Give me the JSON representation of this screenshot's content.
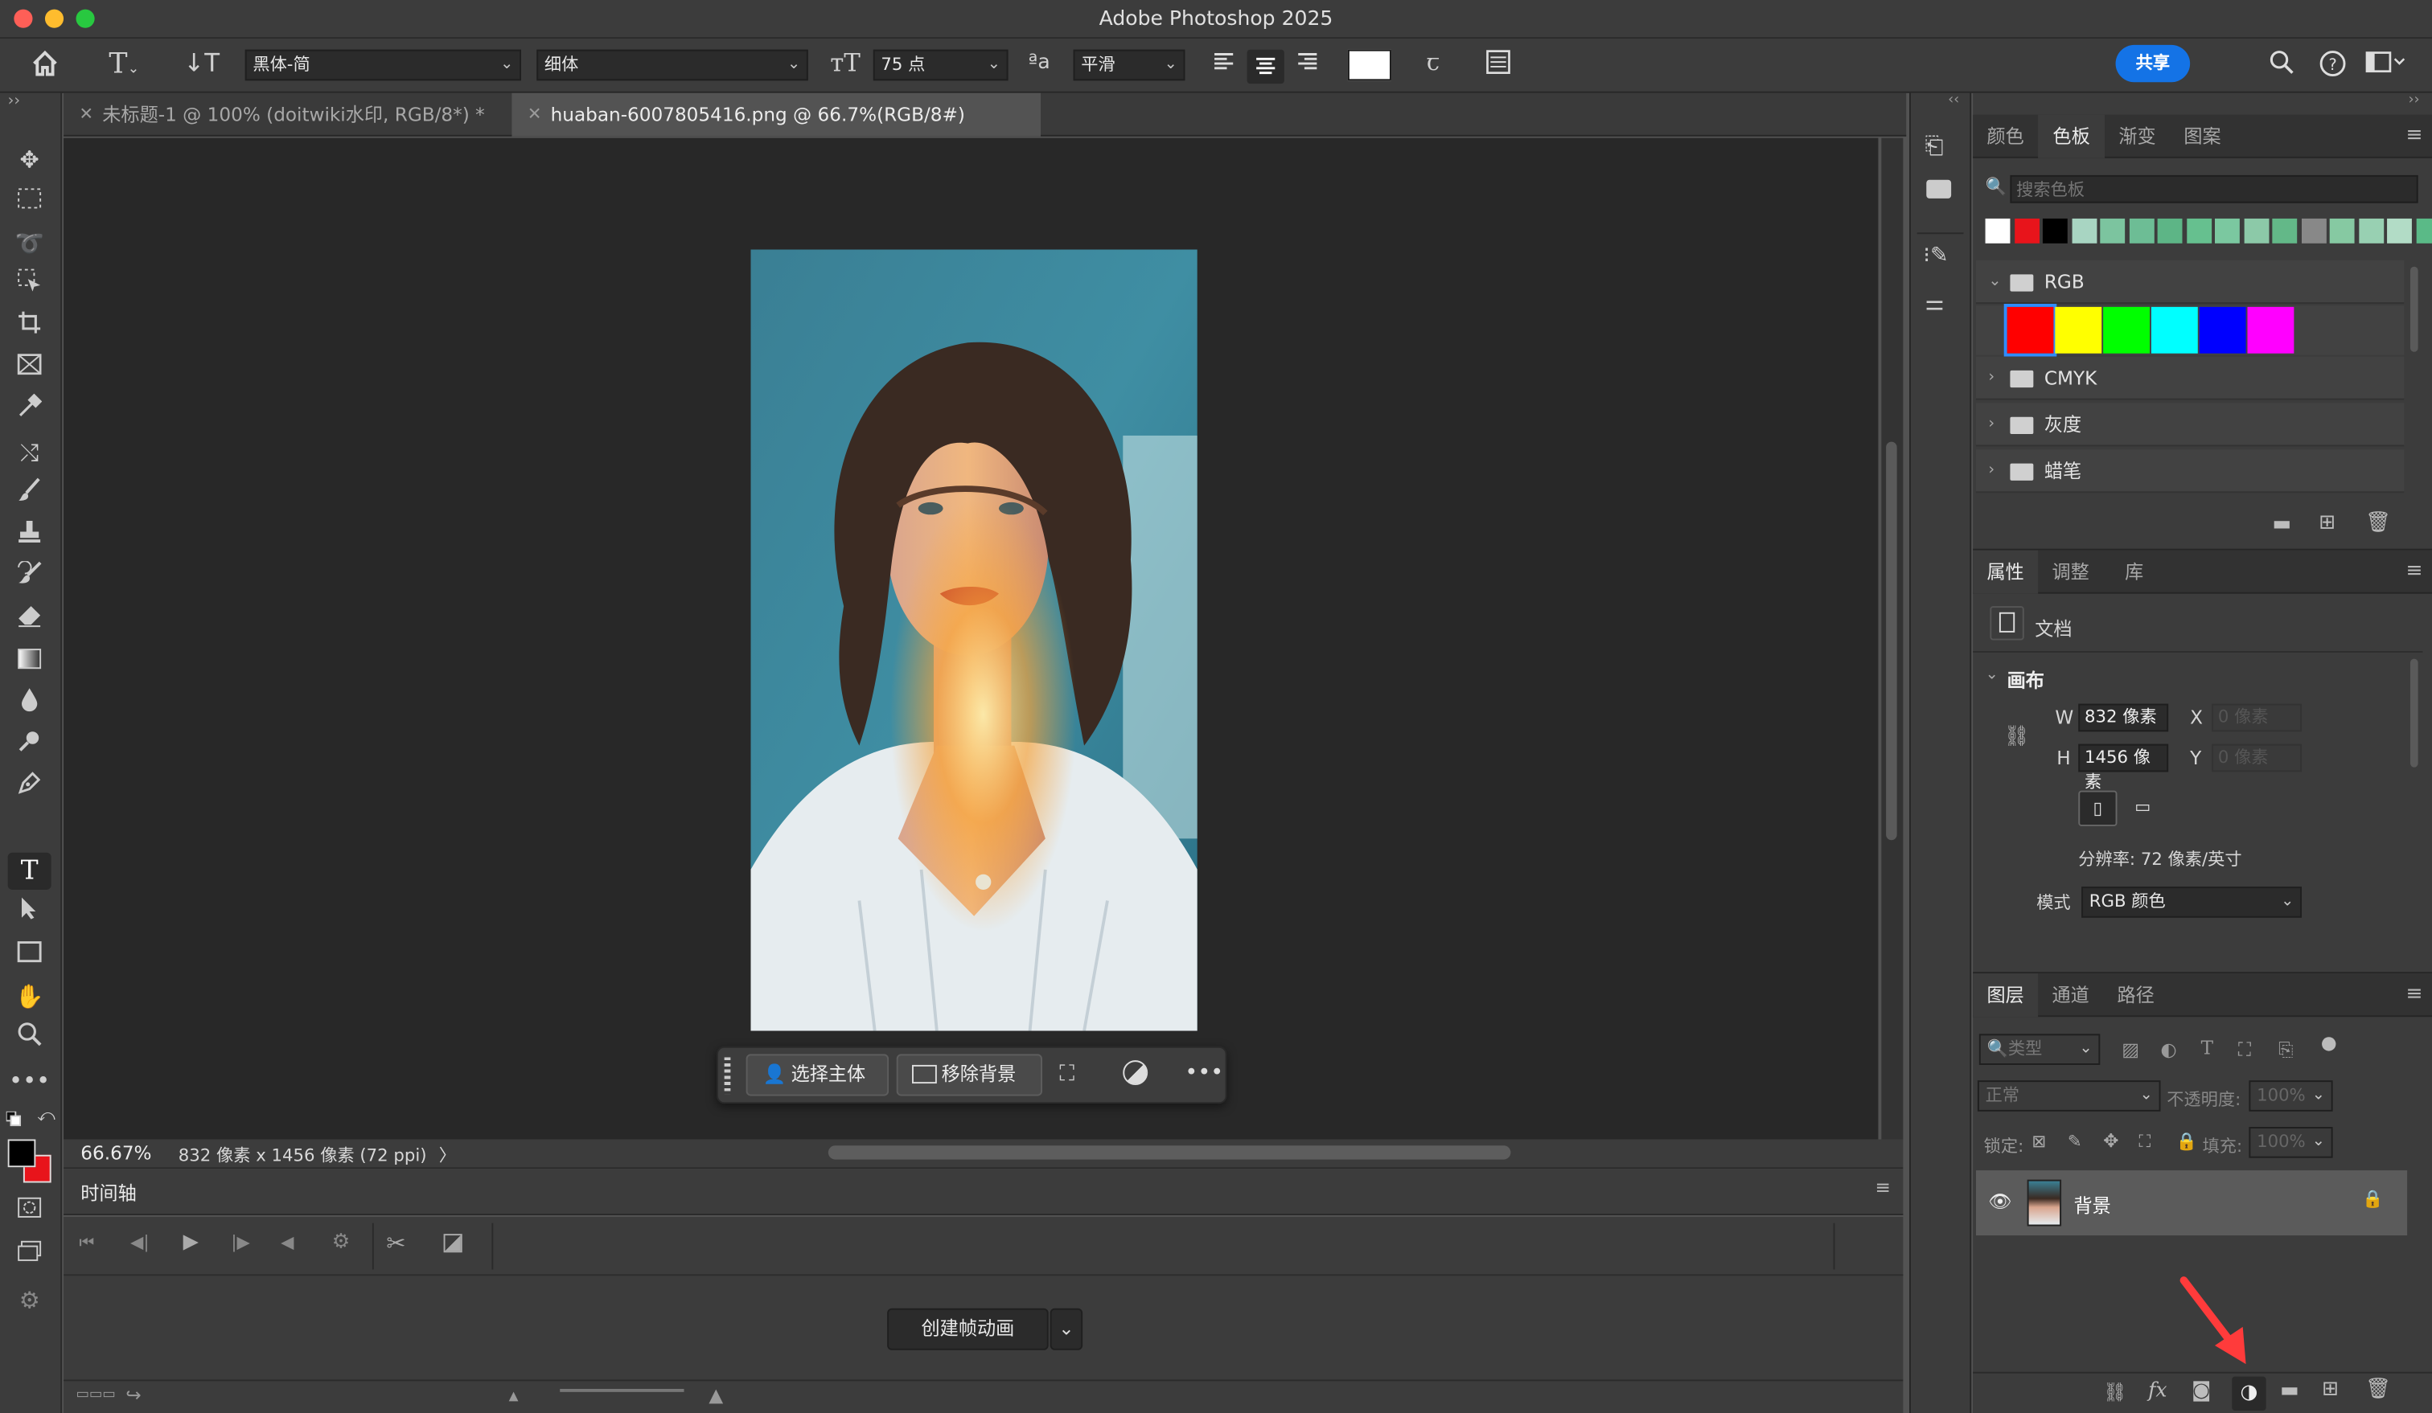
{
  "app": {
    "title": "Adobe Photoshop 2025"
  },
  "options": {
    "font_family": "黑体-简",
    "font_style": "细体",
    "font_size": "75 点",
    "aa_label": "ªa",
    "antialias": "平滑",
    "share": "共享"
  },
  "tabs": [
    {
      "label": "未标题-1 @ 100% (doitwiki水印, RGB/8*) *"
    },
    {
      "label": "huaban-6007805416.png @ 66.7%(RGB/8#)"
    }
  ],
  "contextual": {
    "select_subject": "选择主体",
    "remove_bg": "移除背景"
  },
  "status": {
    "zoom": "66.67%",
    "info": "832 像素 x 1456 像素 (72 ppi)",
    "arrow": "〉"
  },
  "timeline": {
    "title": "时间轴",
    "create_button": "创建帧动画"
  },
  "swatches": {
    "tabs": [
      "颜色",
      "色板",
      "渐变",
      "图案"
    ],
    "search_placeholder": "搜索色板",
    "recent": [
      "#ffffff",
      "#e8141b",
      "#000000",
      "#a8d5c2",
      "#7cc49f",
      "#6dbd95",
      "#5db586",
      "#66c08f",
      "#7bc8a0",
      "#8cc9a8",
      "#63b888",
      "#888888",
      "#86c9a2",
      "#98d0b2",
      "#b2dcc6",
      "#5aba87",
      "#3f9e6c"
    ],
    "groups": [
      {
        "name": "RGB",
        "expanded": true,
        "colors": [
          "#ff0000",
          "#ffff00",
          "#00ff00",
          "#00ffff",
          "#0000ff",
          "#ff00ff"
        ]
      },
      {
        "name": "CMYK"
      },
      {
        "name": "灰度"
      },
      {
        "name": "蜡笔"
      }
    ]
  },
  "properties": {
    "tabs": [
      "属性",
      "调整",
      "库"
    ],
    "doc_label": "文档",
    "canvas_label": "画布",
    "w_label": "W",
    "w_value": "832 像素",
    "h_label": "H",
    "h_value": "1456 像素",
    "x_label": "X",
    "x_value": "0 像素",
    "y_label": "Y",
    "y_value": "0 像素",
    "resolution": "分辨率: 72 像素/英寸",
    "mode_label": "模式",
    "mode_value": "RGB 颜色"
  },
  "layers": {
    "tabs": [
      "图层",
      "通道",
      "路径"
    ],
    "filter_kind": "类型",
    "blend_mode": "正常",
    "opacity_label": "不透明度:",
    "opacity_value": "100%",
    "lock_label": "锁定:",
    "fill_label": "填充:",
    "fill_value": "100%",
    "items": [
      {
        "name": "背景",
        "locked": true,
        "visible": true
      }
    ]
  },
  "annotation": {
    "color": "#ff3b3b"
  }
}
